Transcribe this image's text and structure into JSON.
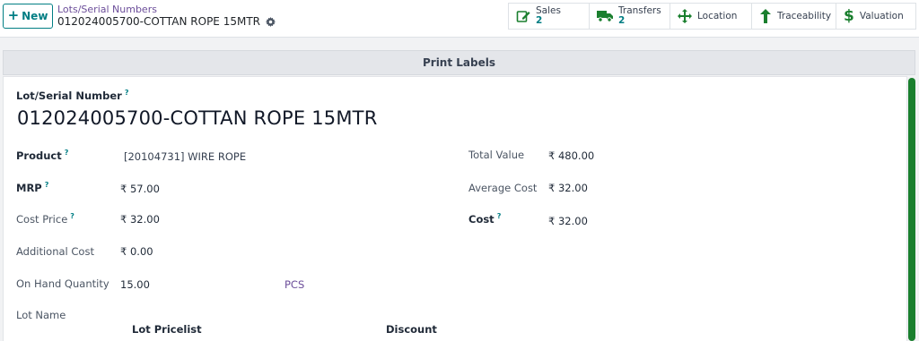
{
  "control": {
    "new_label": "New",
    "breadcrumb": "Lots/Serial Numbers",
    "record_title": "012024005700-COTTAN ROPE 15MTR"
  },
  "smart_buttons": {
    "sales": {
      "label": "Sales",
      "count": "2",
      "icon": "edit-icon"
    },
    "transfers": {
      "label": "Transfers",
      "count": "2",
      "icon": "truck-icon"
    },
    "location": {
      "label": "Location",
      "icon": "arrows-move-icon"
    },
    "traceability": {
      "label": "Traceability",
      "icon": "arrow-up-icon"
    },
    "valuation": {
      "label": "Valuation",
      "icon": "dollar-icon"
    }
  },
  "status_bar": {
    "print_labels": "Print Labels"
  },
  "form": {
    "lot_label": "Lot/Serial Number",
    "lot_value": "012024005700-COTTAN ROPE 15MTR",
    "product_label": "Product",
    "product_value": "[20104731] WIRE ROPE",
    "mrp_label": "MRP",
    "mrp_value": "₹ 57.00",
    "cost_price_label": "Cost Price",
    "cost_price_value": "₹ 32.00",
    "additional_cost_label": "Additional Cost",
    "additional_cost_value": "₹ 0.00",
    "on_hand_label": "On Hand Quantity",
    "on_hand_value": "15.00",
    "uom": "PCS",
    "total_value_label": "Total Value",
    "total_value_value": "₹ 480.00",
    "avg_cost_label": "Average Cost",
    "avg_cost_value": "₹ 32.00",
    "cost_label": "Cost",
    "cost_value": "₹ 32.00",
    "lot_name_label": "Lot Name",
    "pricelist_header": "Lot Pricelist",
    "discount_header": "Discount"
  },
  "colors": {
    "accent": "#017e84",
    "link": "#6c4e9a",
    "scrollbar": "#1a7f2e"
  }
}
